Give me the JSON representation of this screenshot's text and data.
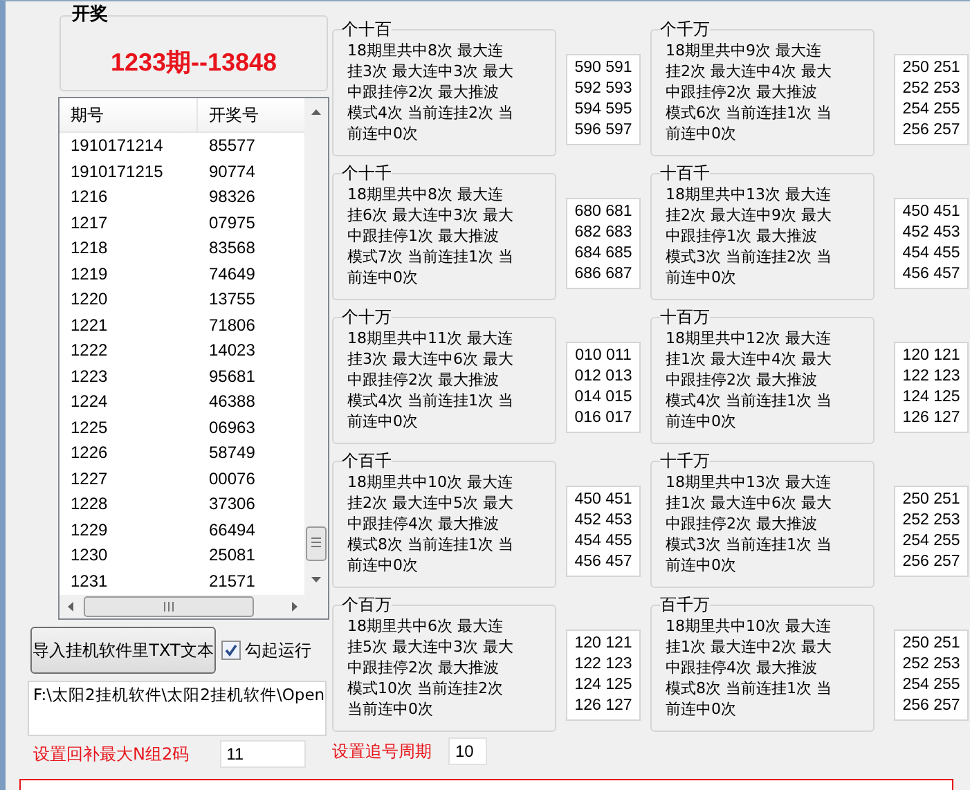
{
  "draw": {
    "legend": "开奖",
    "result": "1233期--13848"
  },
  "history": {
    "columns": [
      "期号",
      "开奖号"
    ],
    "rows": [
      [
        "1910171214",
        "85577"
      ],
      [
        "1910171215",
        "90774"
      ],
      [
        "1216",
        "98326"
      ],
      [
        "1217",
        "07975"
      ],
      [
        "1218",
        "83568"
      ],
      [
        "1219",
        "74649"
      ],
      [
        "1220",
        "13755"
      ],
      [
        "1221",
        "71806"
      ],
      [
        "1222",
        "14023"
      ],
      [
        "1223",
        "95681"
      ],
      [
        "1224",
        "46388"
      ],
      [
        "1225",
        "06963"
      ],
      [
        "1226",
        "58749"
      ],
      [
        "1227",
        "00076"
      ],
      [
        "1228",
        "37306"
      ],
      [
        "1229",
        "66494"
      ],
      [
        "1230",
        "25081"
      ],
      [
        "1231",
        "21571"
      ]
    ]
  },
  "import_button": "导入挂机软件里TXT文本",
  "auto_run": {
    "label": "勾起运行",
    "checked": true
  },
  "path": "F:\\太阳2挂机软件\\太阳2挂机软件\\Open",
  "max_groups": {
    "label": "设置回补最大N组2码",
    "value": "11"
  },
  "chase_period": {
    "label": "设置追号周期",
    "value": "10"
  },
  "columns": [
    [
      {
        "title": "个十百",
        "stats": [
          "18期里共中8次 最大连",
          "挂3次 最大连中3次 最大",
          "中跟挂停2次 最大推波",
          "模式4次 当前连挂2次 当",
          "前连中0次"
        ],
        "numbers": [
          "590 591",
          "592 593",
          "594 595",
          "596 597"
        ]
      },
      {
        "title": "个十千",
        "stats": [
          "18期里共中8次 最大连",
          "挂6次 最大连中3次 最大",
          "中跟挂停1次 最大推波",
          "模式7次 当前连挂1次 当",
          "前连中0次"
        ],
        "numbers": [
          "680 681",
          "682 683",
          "684 685",
          "686 687"
        ]
      },
      {
        "title": "个十万",
        "stats": [
          "18期里共中11次 最大连",
          "挂3次 最大连中6次 最大",
          "中跟挂停2次 最大推波",
          "模式4次 当前连挂1次 当",
          "前连中0次"
        ],
        "numbers": [
          "010 011",
          "012 013",
          "014 015",
          "016 017"
        ]
      },
      {
        "title": "个百千",
        "stats": [
          "18期里共中10次 最大连",
          "挂2次 最大连中5次 最大",
          "中跟挂停4次 最大推波",
          "模式8次 当前连挂1次 当",
          "前连中0次"
        ],
        "numbers": [
          "450 451",
          "452 453",
          "454 455",
          "456 457"
        ]
      },
      {
        "title": "个百万",
        "stats": [
          "18期里共中6次 最大连",
          "挂5次 最大连中3次 最大",
          "中跟挂停2次 最大推波",
          "模式10次 当前连挂2次",
          "当前连中0次"
        ],
        "numbers": [
          "120 121",
          "122 123",
          "124 125",
          "126 127"
        ]
      }
    ],
    [
      {
        "title": "个千万",
        "stats": [
          "18期里共中9次 最大连",
          "挂2次 最大连中4次 最大",
          "中跟挂停2次 最大推波",
          "模式6次 当前连挂1次 当",
          "前连中0次"
        ],
        "numbers": [
          "250 251",
          "252 253",
          "254 255",
          "256 257"
        ]
      },
      {
        "title": "十百千",
        "stats": [
          "18期里共中13次 最大连",
          "挂2次 最大连中9次 最大",
          "中跟挂停1次 最大推波",
          "模式3次 当前连挂2次 当",
          "前连中0次"
        ],
        "numbers": [
          "450 451",
          "452 453",
          "454 455",
          "456 457"
        ]
      },
      {
        "title": "十百万",
        "stats": [
          "18期里共中12次 最大连",
          "挂1次 最大连中4次 最大",
          "中跟挂停2次 最大推波",
          "模式4次 当前连挂1次 当",
          "前连中0次"
        ],
        "numbers": [
          "120 121",
          "122 123",
          "124 125",
          "126 127"
        ]
      },
      {
        "title": "十千万",
        "stats": [
          "18期里共中13次 最大连",
          "挂1次 最大连中6次 最大",
          "中跟挂停2次 最大推波",
          "模式3次 当前连挂1次 当",
          "前连中0次"
        ],
        "numbers": [
          "250 251",
          "252 253",
          "254 255",
          "256 257"
        ]
      },
      {
        "title": "百千万",
        "stats": [
          "18期里共中10次 最大连",
          "挂1次 最大连中2次 最大",
          "中跟挂停4次 最大推波",
          "模式8次 当前连挂1次 当",
          "前连中0次"
        ],
        "numbers": [
          "250 251",
          "252 253",
          "254 255",
          "256 257"
        ]
      }
    ]
  ]
}
